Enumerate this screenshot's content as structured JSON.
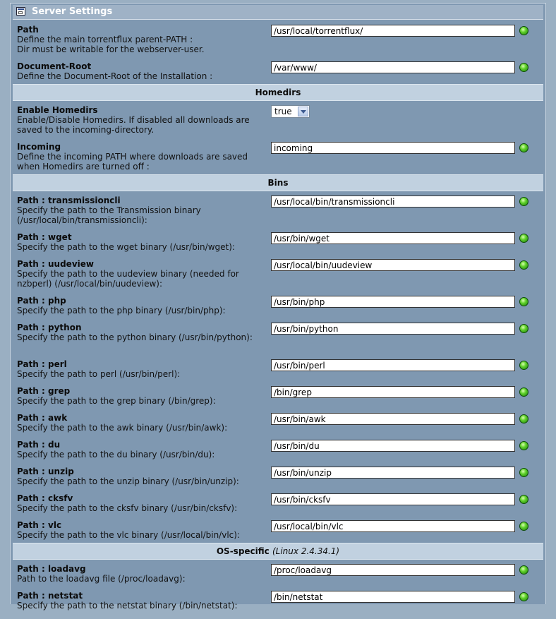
{
  "title": "Server Settings",
  "groups": {
    "server": {
      "rows": [
        {
          "title": "Path",
          "desc": "Define the main torrentflux parent-PATH :\nDir must be writable for the webserver-user.",
          "value": "/usr/local/torrentflux/"
        },
        {
          "title": "Document-Root",
          "desc": "Define the Document-Root of the Installation :",
          "value": "/var/www/"
        }
      ]
    },
    "homedirs": {
      "heading": "Homedirs",
      "enable": {
        "title": "Enable Homedirs",
        "desc": "Enable/Disable Homedirs. If disabled all downloads are saved to the incoming-directory.",
        "selected": "true"
      },
      "incoming": {
        "title": "Incoming",
        "desc": "Define the incoming PATH where downloads are saved when Homedirs are turned off :",
        "value": "incoming"
      }
    },
    "bins": {
      "heading": "Bins",
      "rows": [
        {
          "title": "Path : transmissioncli",
          "desc": "Specify the path to the Transmission binary (/usr/local/bin/transmissioncli):",
          "value": "/usr/local/bin/transmissioncli"
        },
        {
          "title": "Path : wget",
          "desc": "Specify the path to the wget binary (/usr/bin/wget):",
          "value": "/usr/bin/wget"
        },
        {
          "title": "Path : uudeview",
          "desc": "Specify the path to the uudeview binary (needed for nzbperl) (/usr/local/bin/uudeview):",
          "value": "/usr/local/bin/uudeview"
        },
        {
          "title": "Path : php",
          "desc": "Specify the path to the php binary (/usr/bin/php):",
          "value": "/usr/bin/php"
        },
        {
          "title": "Path : python",
          "desc": "Specify the path to the python binary (/usr/bin/python):",
          "value": "/usr/bin/python"
        },
        {
          "title": "Path : perl",
          "desc": "Specify the path to perl (/usr/bin/perl):",
          "value": "/usr/bin/perl"
        },
        {
          "title": "Path : grep",
          "desc": "Specify the path to the grep binary (/bin/grep):",
          "value": "/bin/grep"
        },
        {
          "title": "Path : awk",
          "desc": "Specify the path to the awk binary (/usr/bin/awk):",
          "value": "/usr/bin/awk"
        },
        {
          "title": "Path : du",
          "desc": "Specify the path to the du binary (/usr/bin/du):",
          "value": "/usr/bin/du"
        },
        {
          "title": "Path : unzip",
          "desc": "Specify the path to the unzip binary (/usr/bin/unzip):",
          "value": "/usr/bin/unzip"
        },
        {
          "title": "Path : cksfv",
          "desc": "Specify the path to the cksfv binary (/usr/bin/cksfv):",
          "value": "/usr/bin/cksfv"
        },
        {
          "title": "Path : vlc",
          "desc": "Specify the path to the vlc binary (/usr/local/bin/vlc):",
          "value": "/usr/local/bin/vlc"
        }
      ]
    },
    "os": {
      "heading": "OS-specific",
      "heading_note": "(Linux 2.4.34.1)",
      "rows": [
        {
          "title": "Path : loadavg",
          "desc": "Path to the loadavg file (/proc/loadavg):",
          "value": "/proc/loadavg"
        },
        {
          "title": "Path : netstat",
          "desc": "Specify the path to the netstat binary (/bin/netstat):",
          "value": "/bin/netstat"
        }
      ]
    }
  }
}
